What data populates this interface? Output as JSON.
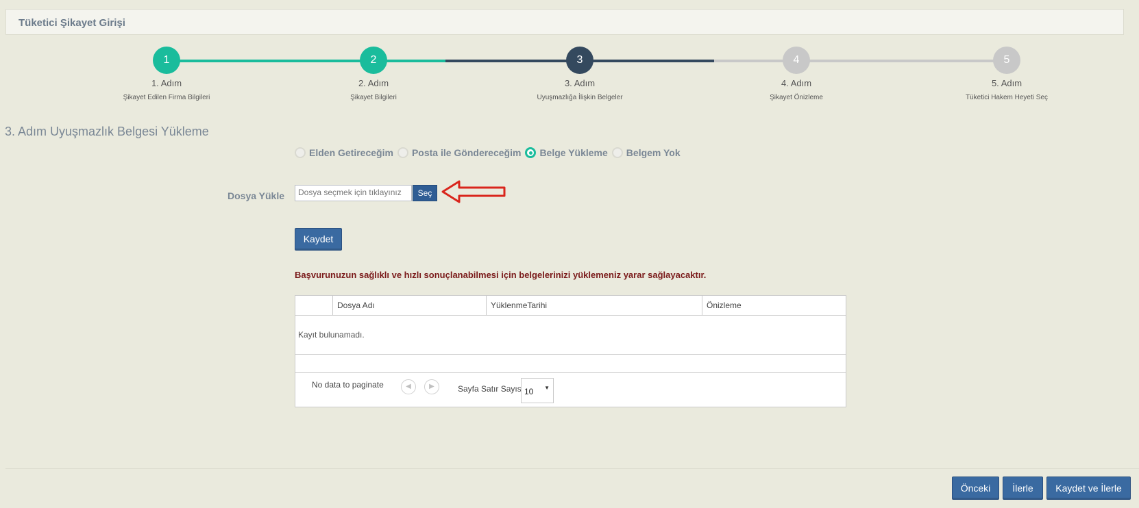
{
  "panel": {
    "title": "Tüketici Şikayet Girişi"
  },
  "steps": [
    {
      "number": "1",
      "label": "1. Adım",
      "sub": "Şikayet Edilen Firma Bilgileri",
      "state": "done"
    },
    {
      "number": "2",
      "label": "2. Adım",
      "sub": "Şikayet Bilgileri",
      "state": "done"
    },
    {
      "number": "3",
      "label": "3. Adım",
      "sub": "Uyuşmazlığa İlişkin Belgeler",
      "state": "current"
    },
    {
      "number": "4",
      "label": "4. Adım",
      "sub": "Şikayet Önizleme",
      "state": "pending"
    },
    {
      "number": "5",
      "label": "5. Adım",
      "sub": "Tüketici Hakem Heyeti Seç",
      "state": "pending"
    }
  ],
  "colors": {
    "done": "#1abc9c",
    "current": "#34495e",
    "pending": "#c8c8c8",
    "primary": "#3a6aa1",
    "warning": "#7a1a1a"
  },
  "section_title": "3. Adım Uyuşmazlık Belgesi Yükleme",
  "delivery_options": [
    {
      "label": "Elden Getireceğim",
      "checked": false
    },
    {
      "label": "Posta ile Göndereceğim",
      "checked": false
    },
    {
      "label": "Belge Yükleme",
      "checked": true
    },
    {
      "label": "Belgem Yok",
      "checked": false
    }
  ],
  "upload": {
    "label": "Dosya Yükle",
    "placeholder": "Dosya seçmek için tıklayınız",
    "choose_label": "Seç",
    "annotation": "red-arrow-pointing-left"
  },
  "save_label": "Kaydet",
  "warning_text": "Başvurunuzun sağlıklı ve hızlı sonuçlanabilmesi için belgelerinizi yüklemeniz yarar sağlayacaktır.",
  "grid": {
    "columns": [
      "",
      "Dosya Adı",
      "YüklenmeTarihi",
      "Önizleme"
    ],
    "empty_text": "Kayıt bulunamadı.",
    "pager_text": "No data to paginate",
    "prev_icon": "chevron-left-icon",
    "next_icon": "chevron-right-icon",
    "rows_label": "Sayfa Satır Sayısı",
    "rows_value": "10"
  },
  "footer": {
    "prev_label": "Önceki",
    "next_label": "İlerle",
    "save_next_label": "Kaydet ve İlerle"
  }
}
